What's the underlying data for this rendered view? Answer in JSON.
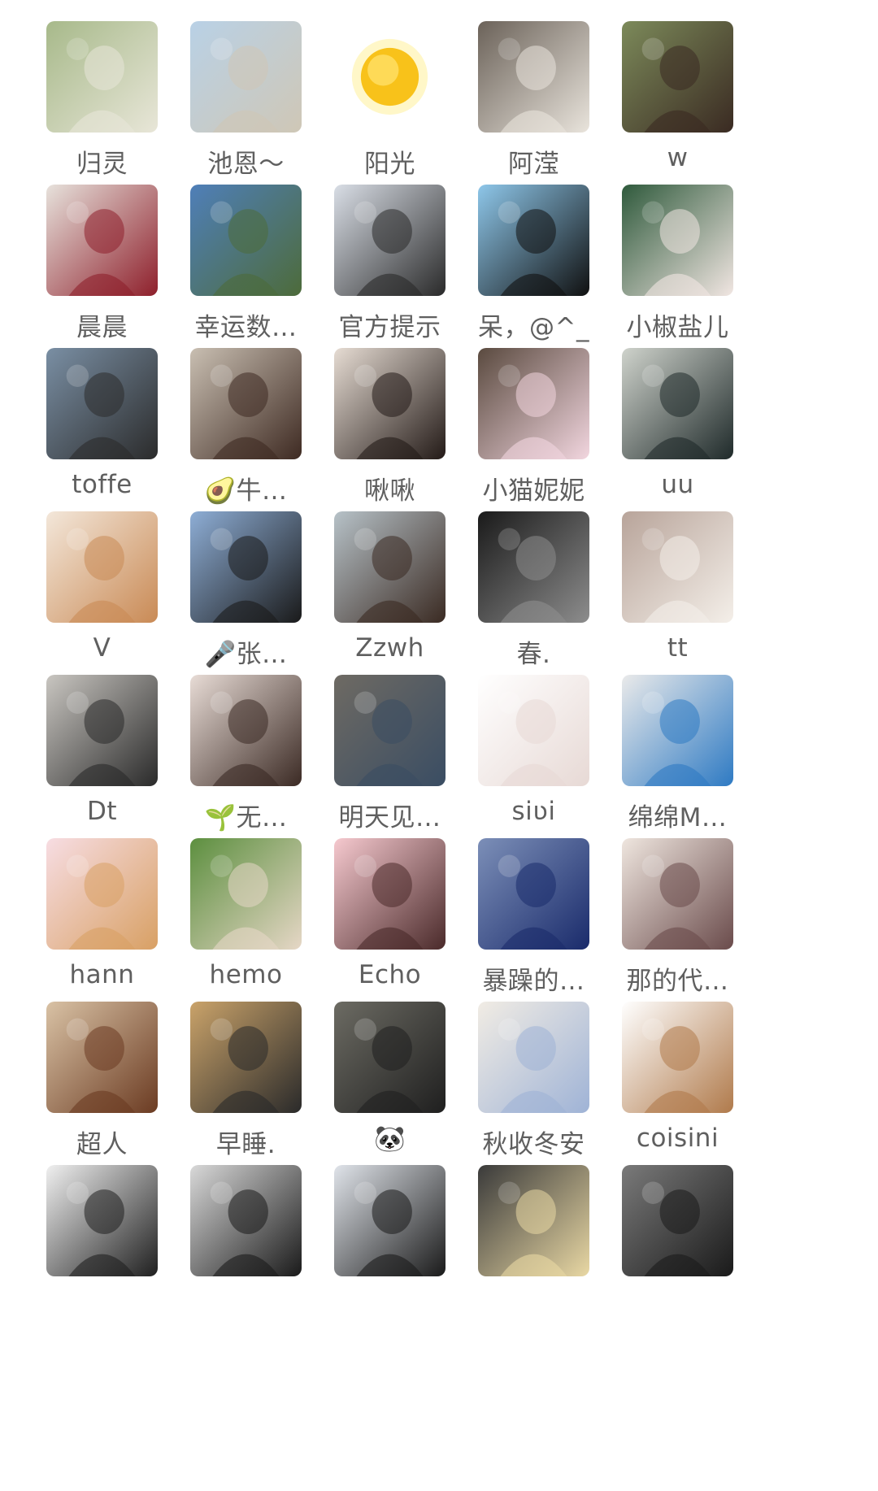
{
  "members": [
    {
      "name": "归灵",
      "avatar_icon": "illustrated-girl-avatar",
      "colors": [
        "#a7b98a",
        "#e8e6d8"
      ]
    },
    {
      "name": "池恩～",
      "avatar_icon": "beach-photo-avatar",
      "colors": [
        "#b9d1e6",
        "#cfc7b6"
      ]
    },
    {
      "name": "阳光",
      "avatar_icon": "sun-icon",
      "colors": [
        "#ffffff",
        "#f8c21a"
      ]
    },
    {
      "name": "阿滢",
      "avatar_icon": "seated-woman-photo-avatar",
      "colors": [
        "#6b6259",
        "#e9e4dc"
      ]
    },
    {
      "name": "w",
      "avatar_icon": "woman-portrait-avatar",
      "colors": [
        "#7c8a5a",
        "#3a2a22"
      ]
    },
    {
      "name": "晨晨",
      "avatar_icon": "gown-photo-avatar",
      "colors": [
        "#e7e2dc",
        "#8e1f2b"
      ]
    },
    {
      "name": "幸运数…",
      "avatar_icon": "mountain-photo-avatar",
      "colors": [
        "#4f7fb9",
        "#4d6b3a"
      ]
    },
    {
      "name": "官方提示",
      "avatar_icon": "snow-photo-avatar",
      "colors": [
        "#d9dee6",
        "#2a2a2a"
      ]
    },
    {
      "name": "呆，@^_",
      "avatar_icon": "black-cat-avatar",
      "colors": [
        "#8ec7ea",
        "#101010"
      ]
    },
    {
      "name": "小椒盐儿",
      "avatar_icon": "cat-on-couch-avatar",
      "colors": [
        "#2f5a3c",
        "#f1e6e2"
      ]
    },
    {
      "name": "toffe",
      "avatar_icon": "woman-car-photo-avatar",
      "colors": [
        "#7a8fa4",
        "#2b2b2b"
      ]
    },
    {
      "name": "🥑牛…",
      "avatar_icon": "child-portrait-avatar",
      "colors": [
        "#c9bfb2",
        "#3e2a22"
      ]
    },
    {
      "name": "啾啾",
      "avatar_icon": "woman-portrait-avatar",
      "colors": [
        "#e6dcd3",
        "#231a17"
      ]
    },
    {
      "name": "小猫妮妮",
      "avatar_icon": "couple-photo-avatar",
      "colors": [
        "#5a4a3f",
        "#f2d6df"
      ]
    },
    {
      "name": "uu",
      "avatar_icon": "selfie-photo-avatar",
      "colors": [
        "#cfd3cc",
        "#1f2a2a"
      ]
    },
    {
      "name": "V",
      "avatar_icon": "sleeping-fox-avatar",
      "colors": [
        "#f3e7da",
        "#c98a55"
      ]
    },
    {
      "name": "🎤张…",
      "avatar_icon": "woman-portrait-avatar",
      "colors": [
        "#8eaed6",
        "#1a1a1a"
      ]
    },
    {
      "name": "Zzwh",
      "avatar_icon": "flowers-photo-avatar",
      "colors": [
        "#b7c2c8",
        "#3a2a22"
      ]
    },
    {
      "name": "春.",
      "avatar_icon": "silhouette-window-avatar",
      "colors": [
        "#1a1a1a",
        "#8d8d8d"
      ]
    },
    {
      "name": "tt",
      "avatar_icon": "angel-illustration-avatar",
      "colors": [
        "#b8a49a",
        "#f4efe9"
      ]
    },
    {
      "name": "Dt",
      "avatar_icon": "mirror-selfie-avatar",
      "colors": [
        "#c9c6c1",
        "#2a2a2a"
      ]
    },
    {
      "name": "🌱无…",
      "avatar_icon": "long-hair-portrait-avatar",
      "colors": [
        "#e8dcd6",
        "#3b2a24"
      ]
    },
    {
      "name": "明天见…",
      "avatar_icon": "alley-photo-avatar",
      "colors": [
        "#6e6a63",
        "#3a4d63"
      ]
    },
    {
      "name": "siʋi",
      "avatar_icon": "sketch-girl-avatar",
      "colors": [
        "#ffffff",
        "#e7d9d5"
      ]
    },
    {
      "name": "绵绵M…",
      "avatar_icon": "white-puppy-avatar",
      "colors": [
        "#eaeaea",
        "#2e7ac3"
      ]
    },
    {
      "name": "hann",
      "avatar_icon": "deer-illustration-avatar",
      "colors": [
        "#f7dde3",
        "#d8a064"
      ]
    },
    {
      "name": "hemo",
      "avatar_icon": "dog-flowers-avatar",
      "colors": [
        "#5c8f3f",
        "#e6d7c6"
      ]
    },
    {
      "name": "Echo",
      "avatar_icon": "cartoon-dog-avatar",
      "colors": [
        "#f6c9cf",
        "#4a2a2a"
      ]
    },
    {
      "name": "暴躁的…",
      "avatar_icon": "motorcycle-photo-avatar",
      "colors": [
        "#7c8fb8",
        "#1a2b6b"
      ]
    },
    {
      "name": "那的代…",
      "avatar_icon": "painted-girl-avatar",
      "colors": [
        "#efe6df",
        "#6a4b4b"
      ]
    },
    {
      "name": "超人",
      "avatar_icon": "smiling-woman-avatar",
      "colors": [
        "#d9c2a5",
        "#6b3b22"
      ]
    },
    {
      "name": "早睡.",
      "avatar_icon": "dog-and-girl-avatar",
      "colors": [
        "#caa36a",
        "#2a2a2a"
      ]
    },
    {
      "name": "🐼",
      "avatar_icon": "woman-cafe-avatar",
      "colors": [
        "#6c6b63",
        "#1f1f1f"
      ]
    },
    {
      "name": "秋收冬安",
      "avatar_icon": "cute-cat-toy-avatar",
      "colors": [
        "#f1ece4",
        "#9fb3d6"
      ]
    },
    {
      "name": "coisini",
      "avatar_icon": "cartoon-cat-avatar",
      "colors": [
        "#ffffff",
        "#b07a4b"
      ]
    },
    {
      "name": "",
      "avatar_icon": "plush-toy-avatar",
      "colors": [
        "#f0f0f0",
        "#1f1f1f"
      ]
    },
    {
      "name": "",
      "avatar_icon": "dark-silhouette-avatar",
      "colors": [
        "#d9d9d9",
        "#1a1a1a"
      ]
    },
    {
      "name": "",
      "avatar_icon": "sunglasses-woman-avatar",
      "colors": [
        "#e0e4ea",
        "#1a1a1a"
      ]
    },
    {
      "name": "",
      "avatar_icon": "eating-girl-avatar",
      "colors": [
        "#3a3a3a",
        "#e9d8a4"
      ]
    },
    {
      "name": "",
      "avatar_icon": "street-woman-avatar",
      "colors": [
        "#7a7a7a",
        "#1a1a1a"
      ]
    }
  ]
}
